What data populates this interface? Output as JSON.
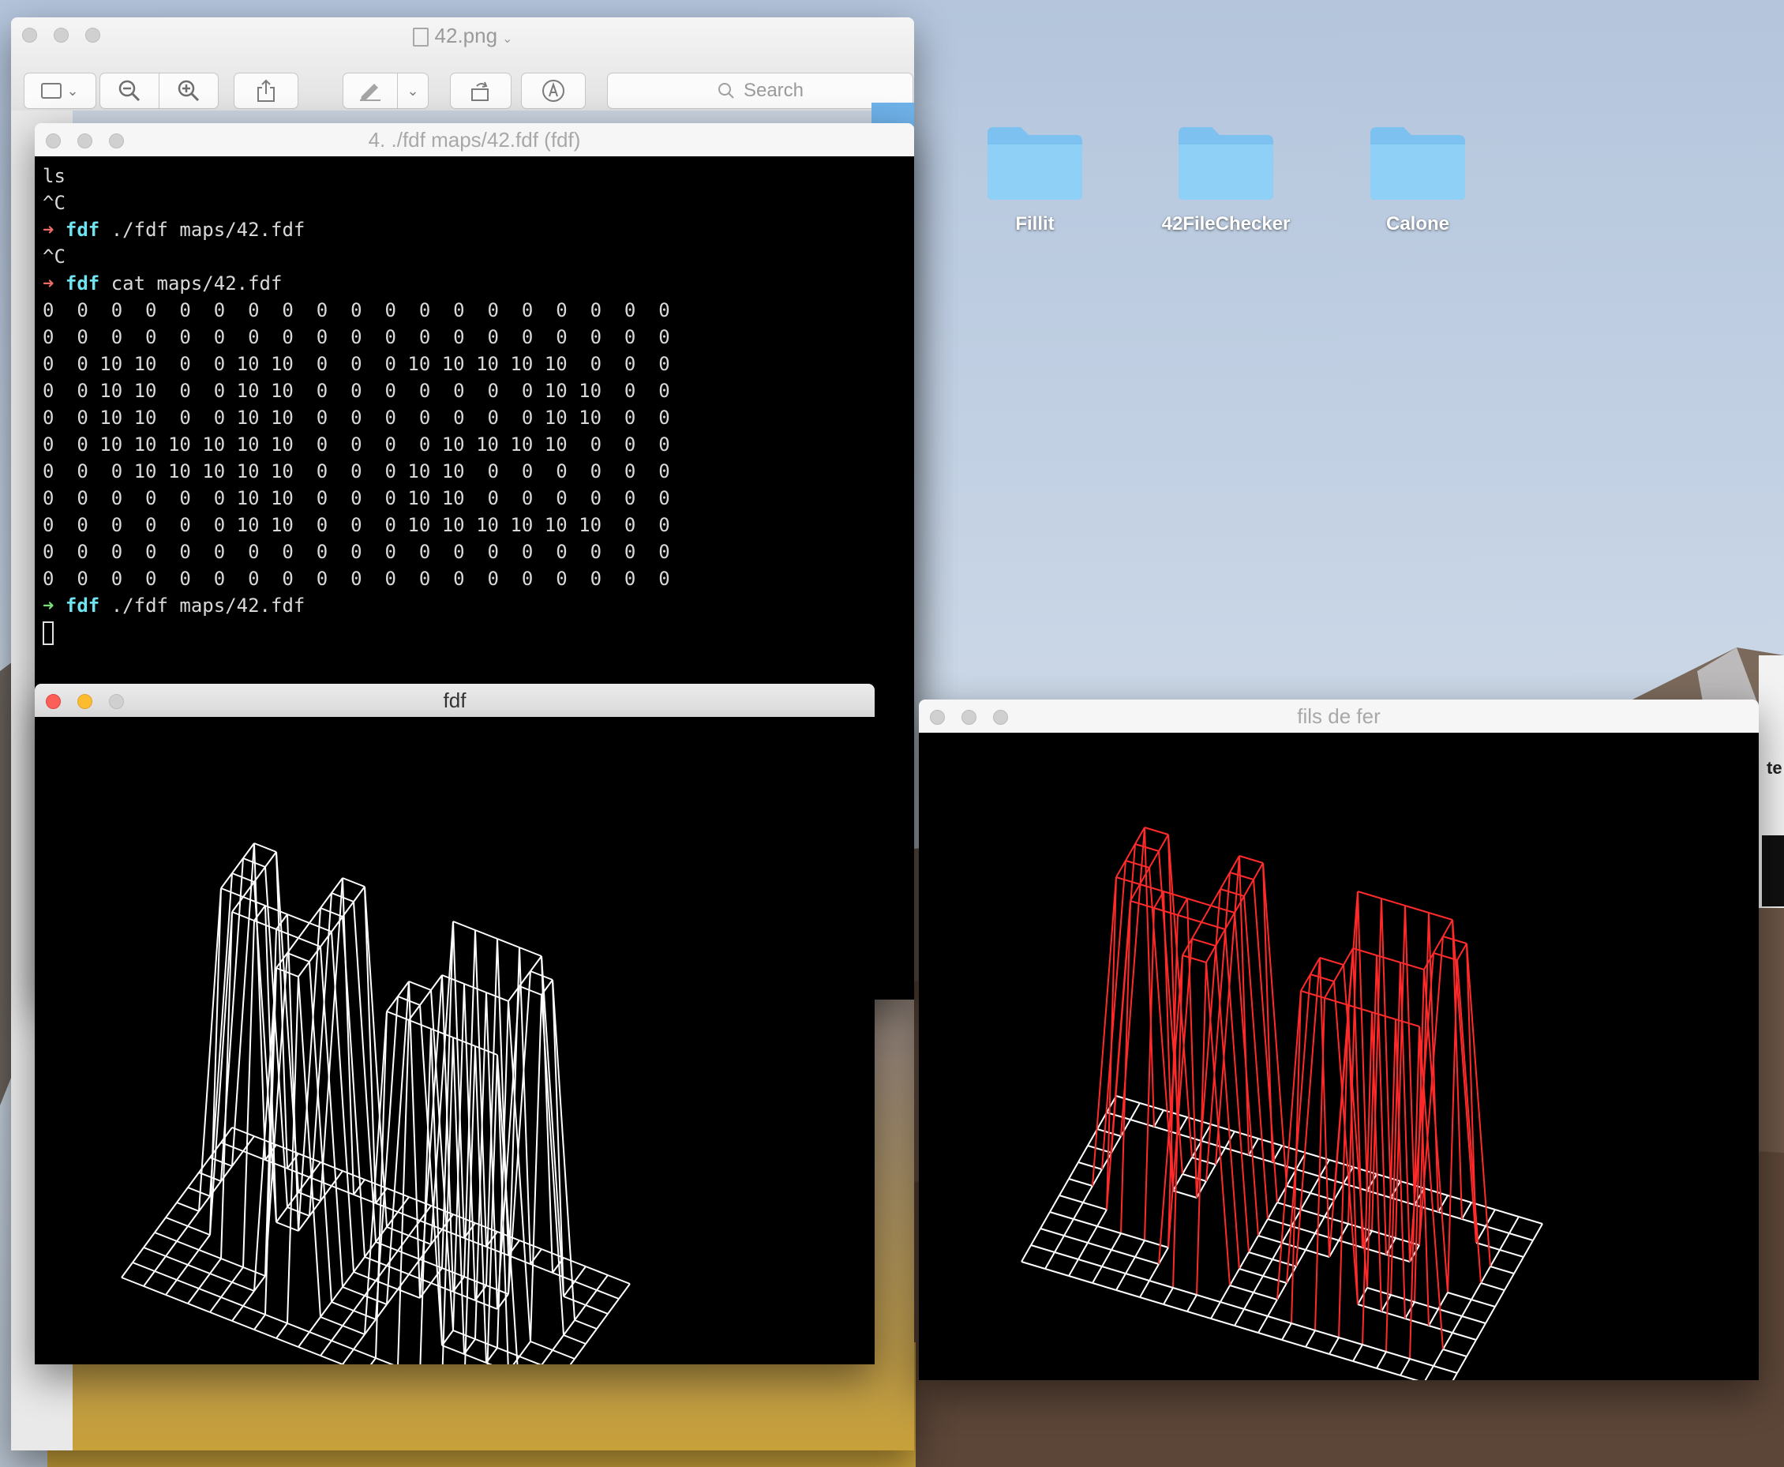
{
  "desktop": {
    "folders": [
      {
        "label": "Fillit"
      },
      {
        "label": "42FileChecker"
      },
      {
        "label": "Calone"
      }
    ],
    "edge_label": "te"
  },
  "preview": {
    "title": "42.png",
    "search_placeholder": "Search"
  },
  "terminal": {
    "title": "4. ./fdf maps/42.fdf (fdf)",
    "lines": [
      {
        "text": "ls"
      },
      {
        "text": "^C"
      },
      {
        "arrow": "➜",
        "arrow_color": "red",
        "dir": "fdf",
        "text": " ./fdf maps/42.fdf"
      },
      {
        "text": "^C"
      },
      {
        "arrow": "➜",
        "arrow_color": "red",
        "dir": "fdf",
        "text": " cat maps/42.fdf"
      }
    ],
    "map_rows": [
      "0  0  0  0  0  0  0  0  0  0  0  0  0  0  0  0  0  0  0",
      "0  0  0  0  0  0  0  0  0  0  0  0  0  0  0  0  0  0  0",
      "0  0 10 10  0  0 10 10  0  0  0 10 10 10 10 10  0  0  0",
      "0  0 10 10  0  0 10 10  0  0  0  0  0  0  0 10 10  0  0",
      "0  0 10 10  0  0 10 10  0  0  0  0  0  0  0 10 10  0  0",
      "0  0 10 10 10 10 10 10  0  0  0  0 10 10 10 10  0  0  0",
      "0  0  0 10 10 10 10 10  0  0  0 10 10  0  0  0  0  0  0",
      "0  0  0  0  0  0 10 10  0  0  0 10 10  0  0  0  0  0  0",
      "0  0  0  0  0  0 10 10  0  0  0 10 10 10 10 10 10  0  0",
      "0  0  0  0  0  0  0  0  0  0  0  0  0  0  0  0  0  0  0",
      "0  0  0  0  0  0  0  0  0  0  0  0  0  0  0  0  0  0  0"
    ],
    "last_prompt": {
      "arrow": "➜",
      "arrow_color": "green",
      "dir": "fdf",
      "text": " ./fdf maps/42.fdf"
    }
  },
  "fdf_window": {
    "title": "fdf",
    "wire_color": "#ffffff"
  },
  "fils_window": {
    "title": "fils de fer",
    "base_color": "#ffffff",
    "low_color": "#ff2a2a",
    "high_color": "#ff9f1a"
  }
}
